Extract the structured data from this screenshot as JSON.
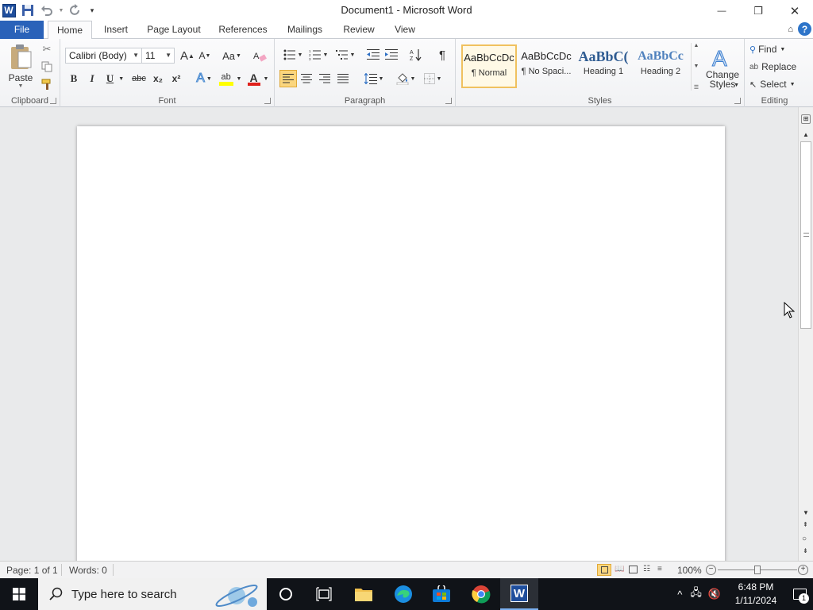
{
  "window": {
    "title": "Document1  -  Microsoft Word",
    "minimize_label": "—",
    "restore_label": "❐",
    "close_label": "✕"
  },
  "qat": {
    "logo_letter": "W"
  },
  "tabs": [
    {
      "label": "File"
    },
    {
      "label": "Home"
    },
    {
      "label": "Insert"
    },
    {
      "label": "Page Layout"
    },
    {
      "label": "References"
    },
    {
      "label": "Mailings"
    },
    {
      "label": "Review"
    },
    {
      "label": "View"
    }
  ],
  "ribbon": {
    "clipboard": {
      "label": "Clipboard",
      "paste": "Paste"
    },
    "font": {
      "label": "Font",
      "font_name": "Calibri (Body)",
      "font_size": "11",
      "grow": "A",
      "shrink": "A",
      "change_case": "Aa",
      "bold": "B",
      "italic": "I",
      "underline": "U",
      "strikethrough": "abc",
      "subscript": "x₂",
      "superscript": "x²",
      "text_effects": "A",
      "font_color": "A"
    },
    "paragraph": {
      "label": "Paragraph",
      "pilcrow": "¶"
    },
    "styles": {
      "label": "Styles",
      "items": [
        {
          "sample": "AaBbCcDc",
          "name": "¶ Normal"
        },
        {
          "sample": "AaBbCcDc",
          "name": "¶ No Spaci..."
        },
        {
          "sample": "AaBbC(",
          "name": "Heading 1"
        },
        {
          "sample": "AaBbCc",
          "name": "Heading 2"
        }
      ],
      "change_styles": "Change Styles"
    },
    "editing": {
      "label": "Editing",
      "find": "Find",
      "replace": "Replace",
      "select": "Select"
    }
  },
  "status": {
    "page": "Page: 1 of 1",
    "words": "Words: 0",
    "zoom": "100%",
    "zoom_level_percent": 100
  },
  "taskbar": {
    "search_placeholder": "Type here to search",
    "time": "6:48 PM",
    "date": "1/11/2024",
    "notification_count": "1"
  },
  "colors": {
    "file_tab": "#2a62b9",
    "highlight": "#ffff00",
    "font_color": "#e0201b",
    "active_style_border": "#f0c15f",
    "taskbar": "#101318"
  }
}
